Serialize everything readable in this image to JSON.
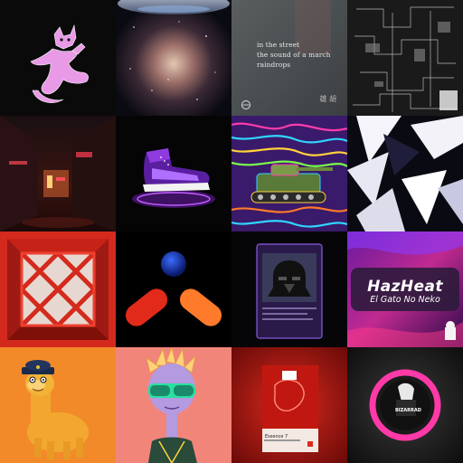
{
  "tiles": [
    {
      "label": "pink-cat-dancer"
    },
    {
      "label": "nebula-galaxy"
    },
    {
      "label": "poem-card",
      "poem": "in the street\nthe sound of a march\nraindrops",
      "signature": "雄 胡"
    },
    {
      "label": "monochrome-abstract"
    },
    {
      "label": "neon-alley"
    },
    {
      "label": "purple-sneaker"
    },
    {
      "label": "psychedelic-tank"
    },
    {
      "label": "shattered-shapes"
    },
    {
      "label": "red-box-mirror"
    },
    {
      "label": "pills-and-sphere"
    },
    {
      "label": "vader-card"
    },
    {
      "label": "hazheat-card",
      "title": "HazHeat",
      "subtitle": "El Gato No Neko"
    },
    {
      "label": "police-llama"
    },
    {
      "label": "alien-sunglasses"
    },
    {
      "label": "essence-card",
      "title": "Essence 7"
    },
    {
      "label": "bizarrad-ring",
      "badge": "BIZARRAD"
    }
  ]
}
